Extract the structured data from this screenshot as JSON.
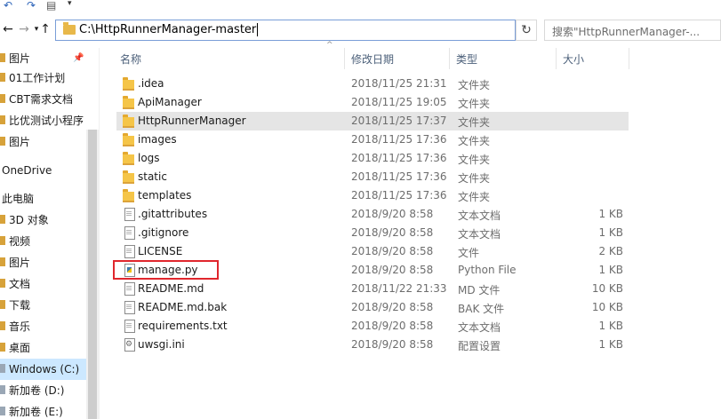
{
  "window": {
    "address_path": "C:\\HttpRunnerManager-master",
    "search_placeholder": "搜索\"HttpRunnerManager-...",
    "accent_color": "#cce8ff",
    "highlight_color": "#e0262d"
  },
  "icons": {
    "undo": "undo-icon",
    "redo": "redo-icon",
    "properties": "properties-icon",
    "back": "back-icon",
    "forward": "forward-icon",
    "history": "history-dropdown-icon",
    "up": "up-arrow-icon",
    "refresh": "refresh-icon",
    "search": "search-icon"
  },
  "sidebar": {
    "items": [
      {
        "label": "图片",
        "pinned": true,
        "type": "folder"
      },
      {
        "label": "01工作计划",
        "type": "folder"
      },
      {
        "label": "CBT需求文档",
        "type": "folder"
      },
      {
        "label": "比优测试小程序",
        "type": "folder"
      },
      {
        "label": "图片",
        "type": "folder"
      },
      {
        "label": "OneDrive",
        "type": "root"
      },
      {
        "label": "此电脑",
        "type": "root"
      },
      {
        "label": "3D 对象",
        "type": "folder"
      },
      {
        "label": "视频",
        "type": "folder"
      },
      {
        "label": "图片",
        "type": "folder"
      },
      {
        "label": "文档",
        "type": "folder"
      },
      {
        "label": "下载",
        "type": "folder"
      },
      {
        "label": "音乐",
        "type": "folder"
      },
      {
        "label": "桌面",
        "type": "folder"
      },
      {
        "label": "Windows (C:)",
        "type": "drive",
        "selected": true
      },
      {
        "label": "新加卷 (D:)",
        "type": "drive"
      },
      {
        "label": "新加卷 (E:)",
        "type": "drive"
      }
    ]
  },
  "columns": {
    "name": "名称",
    "date": "修改日期",
    "type": "类型",
    "size": "大小"
  },
  "files": [
    {
      "name": ".idea",
      "date": "2018/11/25 21:31",
      "type": "文件夹",
      "size": "",
      "icon": "folder"
    },
    {
      "name": "ApiManager",
      "date": "2018/11/25 19:05",
      "type": "文件夹",
      "size": "",
      "icon": "folder"
    },
    {
      "name": "HttpRunnerManager",
      "date": "2018/11/25 17:37",
      "type": "文件夹",
      "size": "",
      "icon": "folder",
      "hover": true
    },
    {
      "name": "images",
      "date": "2018/11/25 17:36",
      "type": "文件夹",
      "size": "",
      "icon": "folder"
    },
    {
      "name": "logs",
      "date": "2018/11/25 17:36",
      "type": "文件夹",
      "size": "",
      "icon": "folder"
    },
    {
      "name": "static",
      "date": "2018/11/25 17:36",
      "type": "文件夹",
      "size": "",
      "icon": "folder"
    },
    {
      "name": "templates",
      "date": "2018/11/25 17:36",
      "type": "文件夹",
      "size": "",
      "icon": "folder"
    },
    {
      "name": ".gitattributes",
      "date": "2018/9/20 8:58",
      "type": "文本文档",
      "size": "1 KB",
      "icon": "file"
    },
    {
      "name": ".gitignore",
      "date": "2018/9/20 8:58",
      "type": "文本文档",
      "size": "1 KB",
      "icon": "file"
    },
    {
      "name": "LICENSE",
      "date": "2018/9/20 8:58",
      "type": "文件",
      "size": "2 KB",
      "icon": "file"
    },
    {
      "name": "manage.py",
      "date": "2018/9/20 8:58",
      "type": "Python File",
      "size": "1 KB",
      "icon": "python",
      "highlighted": true
    },
    {
      "name": "README.md",
      "date": "2018/11/22 21:33",
      "type": "MD 文件",
      "size": "10 KB",
      "icon": "file"
    },
    {
      "name": "README.md.bak",
      "date": "2018/9/20 8:58",
      "type": "BAK 文件",
      "size": "10 KB",
      "icon": "file"
    },
    {
      "name": "requirements.txt",
      "date": "2018/9/20 8:58",
      "type": "文本文档",
      "size": "1 KB",
      "icon": "file"
    },
    {
      "name": "uwsgi.ini",
      "date": "2018/9/20 8:58",
      "type": "配置设置",
      "size": "1 KB",
      "icon": "config"
    }
  ]
}
